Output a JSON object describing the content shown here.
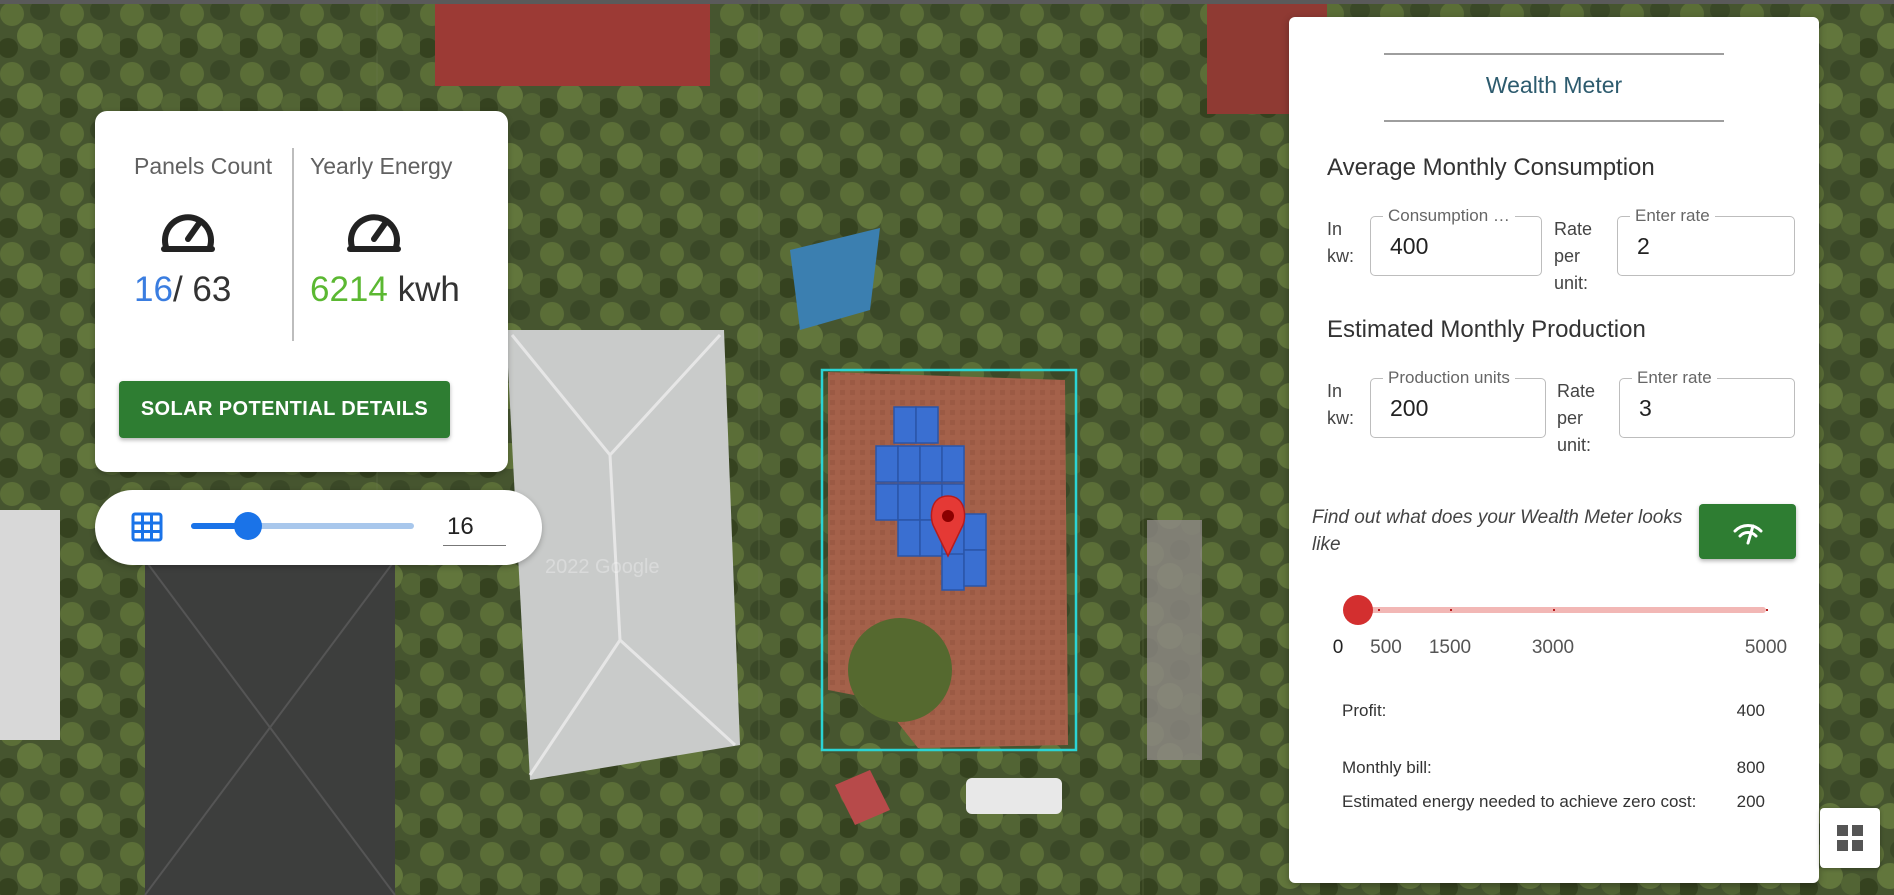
{
  "stats": {
    "panels_label": "Panels Count",
    "panels_value": "16",
    "panels_total": "/ 63",
    "energy_label": "Yearly Energy",
    "energy_value": "6214",
    "energy_unit": " kwh",
    "details_button": "SOLAR POTENTIAL DETAILS",
    "icons": [
      "speedometer-icon",
      "speedometer-icon"
    ]
  },
  "panel_slider": {
    "icon": "grid-icon",
    "value": "16",
    "min": 0,
    "max": 63,
    "level": 16
  },
  "map": {
    "watermark": "2022 Google",
    "marker_icon": "location-pin-icon"
  },
  "wealth": {
    "title": "Wealth Meter",
    "consumption": {
      "heading": "Average Monthly Consumption",
      "unit_label": "In kw:",
      "field_label": "Consumption …",
      "field_value": "400",
      "rate_label": "Rate per unit:",
      "rate_field_label": "Enter rate",
      "rate_value": "2"
    },
    "production": {
      "heading": "Estimated Monthly Production",
      "unit_label": "In kw:",
      "field_label": "Production units",
      "field_value": "200",
      "rate_label": "Rate per unit:",
      "rate_field_label": "Enter rate",
      "rate_value": "3"
    },
    "find_text": "Find out what does your Wealth Meter looks like",
    "meter_button_icon": "wifi-signal-icon",
    "meter_slider": {
      "min": 0,
      "max": 5000,
      "value": 200,
      "marks": [
        "0",
        "500",
        "1500",
        "3000",
        "5000"
      ]
    },
    "results": {
      "profit_label": "Profit:",
      "profit_value": "400",
      "bill_label": "Monthly bill:",
      "bill_value": "800",
      "zero_label": "Estimated energy needed to achieve zero cost:",
      "zero_value": "200"
    }
  },
  "layout_button_icon": "dashboard-icon",
  "colors": {
    "primary_green": "#2e7d32",
    "panel_blue": "#3a7de0",
    "energy_green": "#5bb832",
    "meter_red": "#d32f2f",
    "slider_blue": "#1a73e8"
  }
}
